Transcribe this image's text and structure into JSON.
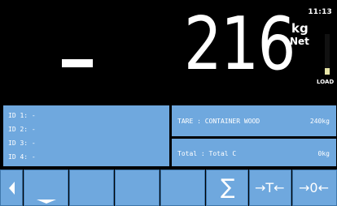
{
  "header": {
    "clock": "11:13"
  },
  "display": {
    "sign": "-",
    "weight": "216",
    "unit": "kg",
    "mode": "Net",
    "load_label": "LOAD",
    "load_fraction": 0.15
  },
  "ids": [
    "ID 1: -",
    "ID 2: -",
    "ID 3: -",
    "ID 4: -"
  ],
  "tare": {
    "label": "TARE  : CONTAINER WOOD",
    "value": "240kg"
  },
  "total": {
    "label": "Total : Total C",
    "value": "0kg"
  },
  "softkeys": {
    "back_icon": "triangle-left-icon",
    "keys": [
      {
        "icon": "underline-marker-icon"
      },
      {
        "icon": "blank"
      },
      {
        "icon": "blank"
      },
      {
        "icon": "blank"
      },
      {
        "icon": "sum-icon",
        "glyph": "∑"
      },
      {
        "icon": "tare-icon",
        "glyph": "→T←"
      },
      {
        "icon": "zero-icon",
        "glyph": "→0←"
      }
    ]
  }
}
